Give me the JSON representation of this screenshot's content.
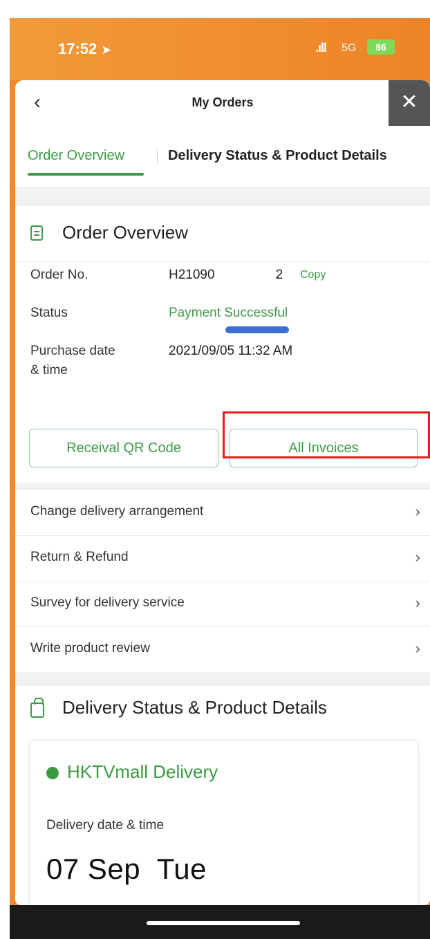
{
  "status_bar": {
    "time": "17:52",
    "location_icon": "location-arrow-icon",
    "signal": ".ıll",
    "network": "5G",
    "battery": "86"
  },
  "nav": {
    "back_icon": "chevron-left-icon",
    "title": "My Orders",
    "close_icon": "close-icon"
  },
  "tabs": [
    {
      "label": "Order Overview",
      "active": true
    },
    {
      "label": "Delivery Status & Product Details",
      "active": false
    }
  ],
  "overview": {
    "title": "Order Overview",
    "order_no_label": "Order No.",
    "order_no_value": "H21090",
    "order_no_suffix": "2",
    "copy_label": "Copy",
    "status_label": "Status",
    "status_value": "Payment Successful",
    "purchase_label_line1": "Purchase date",
    "purchase_label_line2": "& time",
    "purchase_value": "2021/09/05 11:32 AM",
    "qr_button": "Receival QR Code",
    "invoices_button": "All Invoices"
  },
  "menu": [
    {
      "label": "Change delivery arrangement"
    },
    {
      "label": "Return & Refund"
    },
    {
      "label": "Survey for delivery service"
    },
    {
      "label": "Write product review"
    }
  ],
  "delivery": {
    "title": "Delivery Status & Product Details",
    "card_title": "HKTVmall Delivery",
    "date_label": "Delivery date & time",
    "date_value": "07 Sep  Tue"
  },
  "colors": {
    "accent_green": "#3c9b43",
    "header_orange": "#f08a2c",
    "highlight_red": "#e81a1a"
  }
}
